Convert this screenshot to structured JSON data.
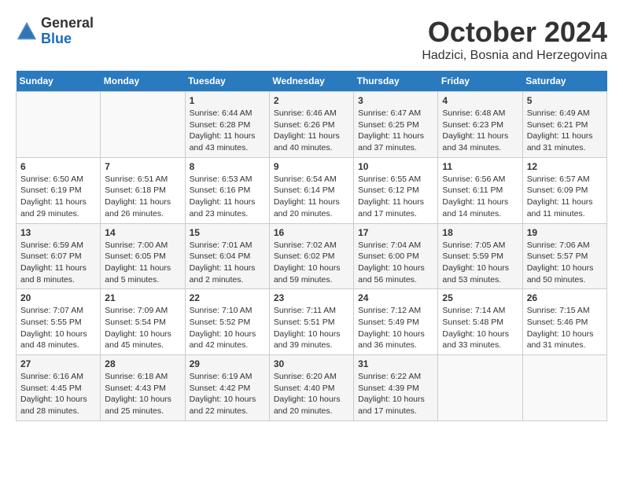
{
  "logo": {
    "general": "General",
    "blue": "Blue"
  },
  "header": {
    "month": "October 2024",
    "location": "Hadzici, Bosnia and Herzegovina"
  },
  "weekdays": [
    "Sunday",
    "Monday",
    "Tuesday",
    "Wednesday",
    "Thursday",
    "Friday",
    "Saturday"
  ],
  "weeks": [
    [
      {
        "day": "",
        "info": ""
      },
      {
        "day": "",
        "info": ""
      },
      {
        "day": "1",
        "info": "Sunrise: 6:44 AM\nSunset: 6:28 PM\nDaylight: 11 hours and 43 minutes."
      },
      {
        "day": "2",
        "info": "Sunrise: 6:46 AM\nSunset: 6:26 PM\nDaylight: 11 hours and 40 minutes."
      },
      {
        "day": "3",
        "info": "Sunrise: 6:47 AM\nSunset: 6:25 PM\nDaylight: 11 hours and 37 minutes."
      },
      {
        "day": "4",
        "info": "Sunrise: 6:48 AM\nSunset: 6:23 PM\nDaylight: 11 hours and 34 minutes."
      },
      {
        "day": "5",
        "info": "Sunrise: 6:49 AM\nSunset: 6:21 PM\nDaylight: 11 hours and 31 minutes."
      }
    ],
    [
      {
        "day": "6",
        "info": "Sunrise: 6:50 AM\nSunset: 6:19 PM\nDaylight: 11 hours and 29 minutes."
      },
      {
        "day": "7",
        "info": "Sunrise: 6:51 AM\nSunset: 6:18 PM\nDaylight: 11 hours and 26 minutes."
      },
      {
        "day": "8",
        "info": "Sunrise: 6:53 AM\nSunset: 6:16 PM\nDaylight: 11 hours and 23 minutes."
      },
      {
        "day": "9",
        "info": "Sunrise: 6:54 AM\nSunset: 6:14 PM\nDaylight: 11 hours and 20 minutes."
      },
      {
        "day": "10",
        "info": "Sunrise: 6:55 AM\nSunset: 6:12 PM\nDaylight: 11 hours and 17 minutes."
      },
      {
        "day": "11",
        "info": "Sunrise: 6:56 AM\nSunset: 6:11 PM\nDaylight: 11 hours and 14 minutes."
      },
      {
        "day": "12",
        "info": "Sunrise: 6:57 AM\nSunset: 6:09 PM\nDaylight: 11 hours and 11 minutes."
      }
    ],
    [
      {
        "day": "13",
        "info": "Sunrise: 6:59 AM\nSunset: 6:07 PM\nDaylight: 11 hours and 8 minutes."
      },
      {
        "day": "14",
        "info": "Sunrise: 7:00 AM\nSunset: 6:05 PM\nDaylight: 11 hours and 5 minutes."
      },
      {
        "day": "15",
        "info": "Sunrise: 7:01 AM\nSunset: 6:04 PM\nDaylight: 11 hours and 2 minutes."
      },
      {
        "day": "16",
        "info": "Sunrise: 7:02 AM\nSunset: 6:02 PM\nDaylight: 10 hours and 59 minutes."
      },
      {
        "day": "17",
        "info": "Sunrise: 7:04 AM\nSunset: 6:00 PM\nDaylight: 10 hours and 56 minutes."
      },
      {
        "day": "18",
        "info": "Sunrise: 7:05 AM\nSunset: 5:59 PM\nDaylight: 10 hours and 53 minutes."
      },
      {
        "day": "19",
        "info": "Sunrise: 7:06 AM\nSunset: 5:57 PM\nDaylight: 10 hours and 50 minutes."
      }
    ],
    [
      {
        "day": "20",
        "info": "Sunrise: 7:07 AM\nSunset: 5:55 PM\nDaylight: 10 hours and 48 minutes."
      },
      {
        "day": "21",
        "info": "Sunrise: 7:09 AM\nSunset: 5:54 PM\nDaylight: 10 hours and 45 minutes."
      },
      {
        "day": "22",
        "info": "Sunrise: 7:10 AM\nSunset: 5:52 PM\nDaylight: 10 hours and 42 minutes."
      },
      {
        "day": "23",
        "info": "Sunrise: 7:11 AM\nSunset: 5:51 PM\nDaylight: 10 hours and 39 minutes."
      },
      {
        "day": "24",
        "info": "Sunrise: 7:12 AM\nSunset: 5:49 PM\nDaylight: 10 hours and 36 minutes."
      },
      {
        "day": "25",
        "info": "Sunrise: 7:14 AM\nSunset: 5:48 PM\nDaylight: 10 hours and 33 minutes."
      },
      {
        "day": "26",
        "info": "Sunrise: 7:15 AM\nSunset: 5:46 PM\nDaylight: 10 hours and 31 minutes."
      }
    ],
    [
      {
        "day": "27",
        "info": "Sunrise: 6:16 AM\nSunset: 4:45 PM\nDaylight: 10 hours and 28 minutes."
      },
      {
        "day": "28",
        "info": "Sunrise: 6:18 AM\nSunset: 4:43 PM\nDaylight: 10 hours and 25 minutes."
      },
      {
        "day": "29",
        "info": "Sunrise: 6:19 AM\nSunset: 4:42 PM\nDaylight: 10 hours and 22 minutes."
      },
      {
        "day": "30",
        "info": "Sunrise: 6:20 AM\nSunset: 4:40 PM\nDaylight: 10 hours and 20 minutes."
      },
      {
        "day": "31",
        "info": "Sunrise: 6:22 AM\nSunset: 4:39 PM\nDaylight: 10 hours and 17 minutes."
      },
      {
        "day": "",
        "info": ""
      },
      {
        "day": "",
        "info": ""
      }
    ]
  ]
}
